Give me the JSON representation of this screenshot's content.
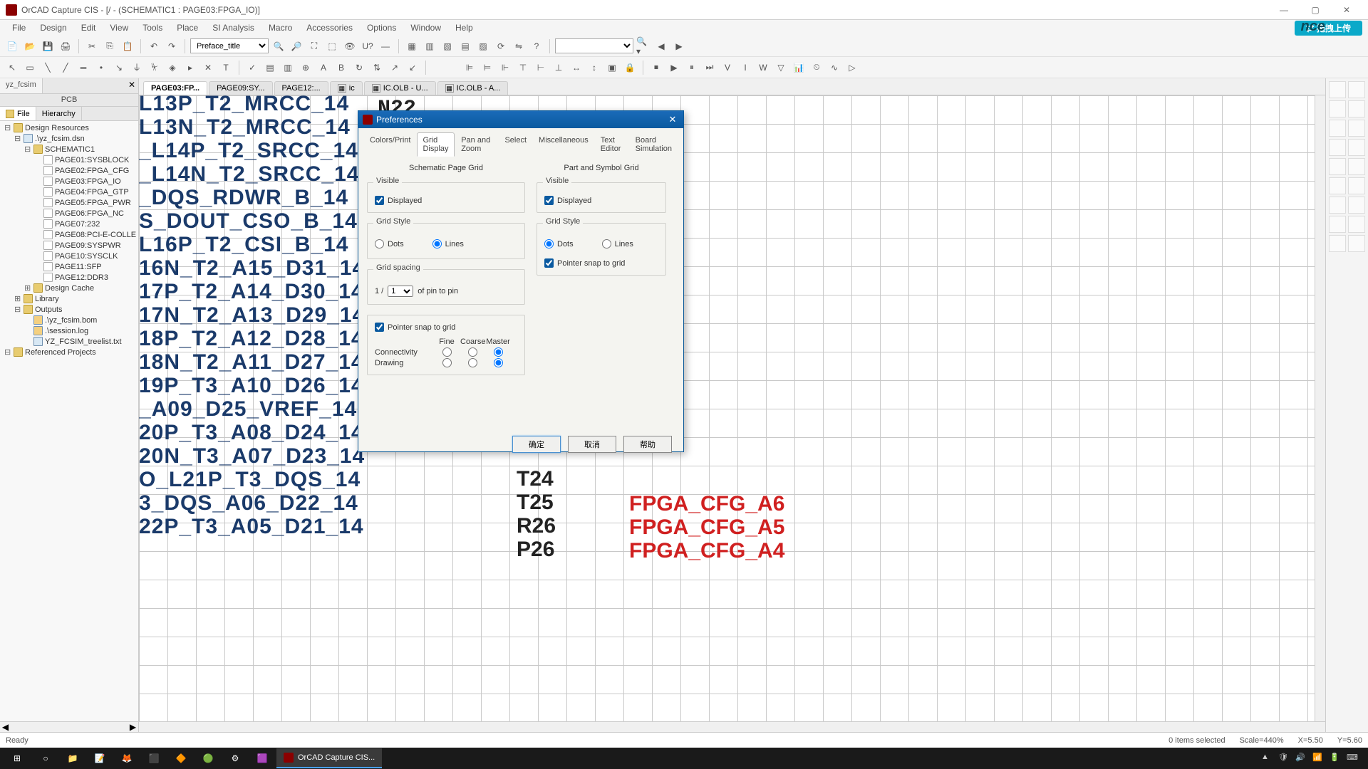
{
  "title": "OrCAD Capture CIS - [/ - (SCHEMATIC1 : PAGE03:FPGA_IO)]",
  "menu": [
    "File",
    "Design",
    "Edit",
    "View",
    "Tools",
    "Place",
    "SI Analysis",
    "Macro",
    "Accessories",
    "Options",
    "Window",
    "Help"
  ],
  "brand_btn_icon": "⇄",
  "brand_btn": "拖拽上传",
  "brand_text": "nce",
  "toolbar1_select": "Preface_title",
  "left_tab": "yz_fcsim",
  "left_pcb": "PCB",
  "left_subtabs": {
    "file": "File",
    "hierarchy": "Hierarchy"
  },
  "tree": {
    "root": "Design Resources",
    "dsn": ".\\yz_fcsim.dsn",
    "sch": "SCHEMATIC1",
    "pages": [
      "PAGE01:SYSBLOCK",
      "PAGE02:FPGA_CFG",
      "PAGE03:FPGA_IO",
      "PAGE04:FPGA_GTP",
      "PAGE05:FPGA_PWR",
      "PAGE06:FPGA_NC",
      "PAGE07:232",
      "PAGE08:PCI-E-COLLE",
      "PAGE09:SYSPWR",
      "PAGE10:SYSCLK",
      "PAGE11:SFP",
      "PAGE12:DDR3"
    ],
    "design_cache": "Design Cache",
    "library": "Library",
    "outputs": "Outputs",
    "out_items": [
      ".\\yz_fcsim.bom",
      ".\\session.log",
      "YZ_FCSIM_treelist.txt"
    ],
    "referenced": "Referenced Projects"
  },
  "doc_tabs": [
    "PAGE03:FP...",
    "PAGE09:SY...",
    "PAGE12:...",
    "ic",
    "IC.OLB - U...",
    "IC.OLB - A..."
  ],
  "schematic_rows": [
    "L13P_T2_MRCC_14",
    "L13N_T2_MRCC_14",
    "_L14P_T2_SRCC_14",
    "_L14N_T2_SRCC_14",
    "_DQS_RDWR_B_14",
    "S_DOUT_CSO_B_14",
    "L16P_T2_CSI_B_14",
    "16N_T2_A15_D31_14",
    "17P_T2_A14_D30_14",
    "17N_T2_A13_D29_14",
    "18P_T2_A12_D28_14",
    "18N_T2_A11_D27_14",
    "19P_T3_A10_D26_14",
    "_A09_D25_VREF_14",
    "20P_T3_A08_D24_14",
    "20N_T3_A07_D23_14",
    "O_L21P_T3_DQS_14",
    "3_DQS_A06_D22_14",
    "22P_T3_A05_D21_14"
  ],
  "right_pins": [
    "T24",
    "T25",
    "R26",
    "P26"
  ],
  "top_pins": "N22",
  "red_nets": [
    "FPGA_CFG_A6",
    "FPGA_CFG_A5",
    "FPGA_CFG_A4"
  ],
  "dialog": {
    "title": "Preferences",
    "tabs": [
      "Colors/Print",
      "Grid Display",
      "Pan and Zoom",
      "Select",
      "Miscellaneous",
      "Text Editor",
      "Board Simulation"
    ],
    "active_tab": 1,
    "left": {
      "title": "Schematic Page Grid",
      "visible_label": "Visible",
      "displayed": "Displayed",
      "grid_style": "Grid Style",
      "dots": "Dots",
      "lines": "Lines",
      "grid_spacing": "Grid spacing",
      "spacing_prefix": "1 /",
      "spacing_value": "1",
      "spacing_suffix": "of pin to pin",
      "pointer_snap": "Pointer snap to grid",
      "cols": {
        "fine": "Fine",
        "coarse": "Coarse",
        "master": "Master"
      },
      "rows": {
        "connectivity": "Connectivity",
        "drawing": "Drawing"
      }
    },
    "right": {
      "title": "Part and Symbol Grid",
      "visible_label": "Visible",
      "displayed": "Displayed",
      "grid_style": "Grid Style",
      "dots": "Dots",
      "lines": "Lines",
      "pointer_snap": "Pointer snap to grid"
    },
    "btns": {
      "ok": "确定",
      "cancel": "取消",
      "help": "帮助"
    }
  },
  "status": {
    "ready": "Ready",
    "items": "0 items selected",
    "scale": "Scale=440%",
    "x": "X=5.50",
    "y": "Y=5.60"
  },
  "taskbar_app": "OrCAD Capture CIS..."
}
